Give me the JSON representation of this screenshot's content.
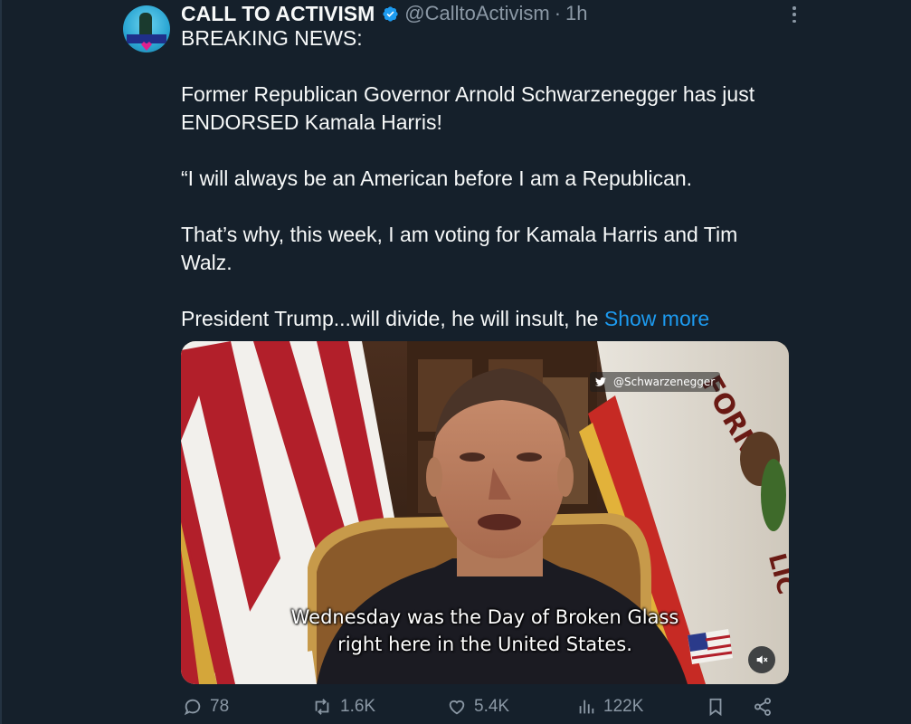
{
  "author": {
    "display_name": "CALL TO ACTIVISM",
    "handle": "@CalltoActivism",
    "time_sep": "·",
    "time": "1h",
    "avatar_text": "CALL TO ACTIVISM",
    "verified": true
  },
  "tweet": {
    "lines": [
      "BREAKING NEWS:",
      "Former Republican Governor Arnold Schwarzenegger has just",
      "ENDORSED Kamala Harris!",
      "“I will always be an American before I am a Republican.",
      "That’s why, this week, I am voting for Kamala Harris and Tim",
      "Walz.",
      "President Trump...will divide, he will insult, he "
    ],
    "show_more": "Show more"
  },
  "media": {
    "watermark": "@Schwarzenegger",
    "caption_line1": "Wednesday was the Day of Broken Glass",
    "caption_line2": "right here in the United States.",
    "flag_text": "FORNIA",
    "flag_text2": "LIC"
  },
  "actions": {
    "replies": "78",
    "reposts": "1.6K",
    "likes": "5.4K",
    "views": "122K"
  },
  "colors": {
    "background": "#15202b",
    "text": "#f7f9f9",
    "muted": "#8b98a5",
    "link": "#1d9bf0",
    "verified": "#1d9bf0"
  },
  "icons": {
    "verified": "verified-badge-icon",
    "more": "more-options-icon",
    "reply": "reply-icon",
    "repost": "repost-icon",
    "like": "heart-icon",
    "views": "views-chart-icon",
    "bookmark": "bookmark-icon",
    "share": "share-icon",
    "mute": "mute-icon"
  }
}
